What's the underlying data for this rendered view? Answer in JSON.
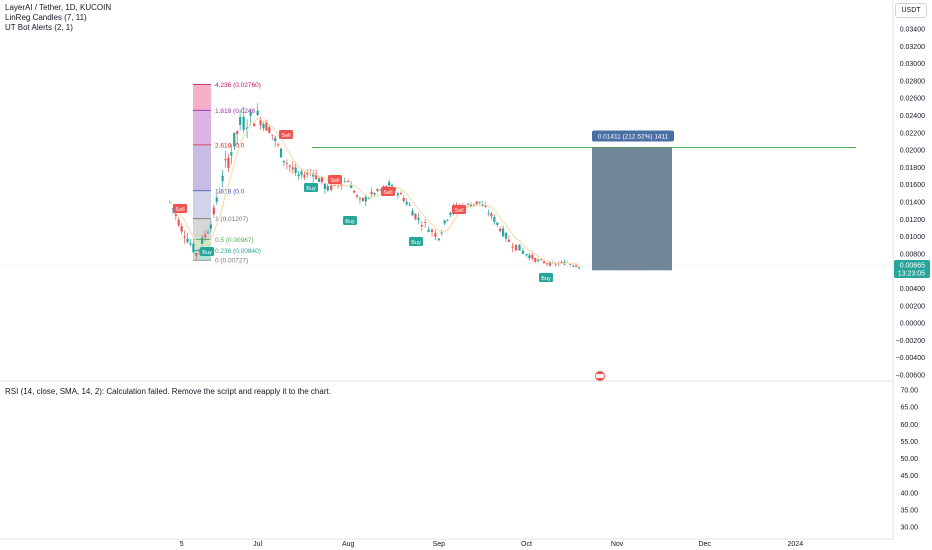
{
  "legend": {
    "symbol": "LayerAI / Tether, 1D, KUCOIN",
    "ind1": "LinReg Candles (7, 11)",
    "ind2": "UT Bot Alerts (2, 1)"
  },
  "currency": "USDT",
  "rsi_message": "RSI (14, close, SMA, 14, 2): Calculation failed. Remove the script and reapply it to the chart.",
  "colors": {
    "up": "#26a69a",
    "down": "#ef5350",
    "hline": "#4caf50",
    "box": "#5b728a",
    "boxlabel": "#4a6fa5"
  },
  "chart_data": {
    "type": "candlestick",
    "price_axis": {
      "ticks": [
        "0.03400",
        "0.03200",
        "0.03000",
        "0.02800",
        "0.02600",
        "0.02400",
        "0.02200",
        "0.02000",
        "0.01800",
        "0.01600",
        "0.01400",
        "0.01200",
        "0.01000",
        "0.00800",
        "0.00600",
        "0.00400",
        "0.00200",
        "0.00000",
        "−0.00200",
        "−0.00400",
        "−0.00600"
      ],
      "range": [
        -0.006,
        0.034
      ]
    },
    "rsi_axis": {
      "ticks": [
        "70.00",
        "65.00",
        "60.00",
        "55.00",
        "50.00",
        "45.00",
        "40.00",
        "35.00",
        "30.00"
      ],
      "range": [
        30,
        70
      ]
    },
    "time_axis": {
      "ticks": [
        "5",
        "Jul",
        "Aug",
        "Sep",
        "Oct",
        "Nov",
        "Dec",
        "2024"
      ]
    },
    "last_price": {
      "value": "0.00665",
      "countdown": "13:23:05"
    },
    "fib_levels": [
      {
        "label": "4.236 (0.02760)",
        "price": 0.0276
      },
      {
        "label": "1.618 (0.0246",
        "price": 0.0246
      },
      {
        "label": "2.618 (0.0",
        "price": 0.0206
      },
      {
        "label": "1.618 (0.0",
        "price": 0.0153
      },
      {
        "label": "1 (0.01207)",
        "price": 0.01207
      },
      {
        "label": "0.5 (0.00967)",
        "price": 0.00967
      },
      {
        "label": "0.236 (0.00840)",
        "price": 0.0084
      },
      {
        "label": "0 (0.00727)",
        "price": 0.00727
      }
    ],
    "horizontal_line": 0.0203,
    "measure_box": {
      "label": "0.01411 (212.52%) 1411",
      "top": 0.0203,
      "bottom": 0.0061
    },
    "signals": [
      {
        "type": "Sell",
        "x": 0.01505
      },
      {
        "type": "Buy",
        "x": 0.0169
      },
      {
        "type": "Sell",
        "x": 0.0259
      },
      {
        "type": "Buy",
        "x": 0.03085
      },
      {
        "type": "Sell",
        "x": 0.0334
      },
      {
        "type": "Buy",
        "x": 0.035
      },
      {
        "type": "Sell",
        "x": 0.041
      },
      {
        "type": "Buy",
        "x": 0.046
      },
      {
        "type": "Sell",
        "x": 0.048
      },
      {
        "type": "Buy",
        "x": 0.06
      }
    ],
    "series": [
      {
        "date": "2023-06-01",
        "o": 0.015,
        "h": 0.017,
        "l": 0.013,
        "c": 0.014
      },
      {
        "date": "2023-06-05",
        "o": 0.014,
        "h": 0.0148,
        "l": 0.0105,
        "c": 0.011
      },
      {
        "date": "2023-06-10",
        "o": 0.011,
        "h": 0.0115,
        "l": 0.0073,
        "c": 0.008
      },
      {
        "date": "2023-06-15",
        "o": 0.008,
        "h": 0.012,
        "l": 0.0075,
        "c": 0.0115
      },
      {
        "date": "2023-06-20",
        "o": 0.0115,
        "h": 0.019,
        "l": 0.011,
        "c": 0.018
      },
      {
        "date": "2023-06-25",
        "o": 0.018,
        "h": 0.025,
        "l": 0.017,
        "c": 0.023
      },
      {
        "date": "2023-07-01",
        "o": 0.023,
        "h": 0.0276,
        "l": 0.0215,
        "c": 0.024
      },
      {
        "date": "2023-07-05",
        "o": 0.024,
        "h": 0.0265,
        "l": 0.022,
        "c": 0.0225
      },
      {
        "date": "2023-07-10",
        "o": 0.0225,
        "h": 0.023,
        "l": 0.0185,
        "c": 0.019
      },
      {
        "date": "2023-07-15",
        "o": 0.019,
        "h": 0.0195,
        "l": 0.0165,
        "c": 0.017
      },
      {
        "date": "2023-07-20",
        "o": 0.017,
        "h": 0.0205,
        "l": 0.016,
        "c": 0.0175
      },
      {
        "date": "2023-07-25",
        "o": 0.0175,
        "h": 0.018,
        "l": 0.015,
        "c": 0.0155
      },
      {
        "date": "2023-08-01",
        "o": 0.0155,
        "h": 0.017,
        "l": 0.0145,
        "c": 0.0165
      },
      {
        "date": "2023-08-05",
        "o": 0.0165,
        "h": 0.0168,
        "l": 0.0135,
        "c": 0.014
      },
      {
        "date": "2023-08-10",
        "o": 0.014,
        "h": 0.0158,
        "l": 0.0136,
        "c": 0.015
      },
      {
        "date": "2023-08-15",
        "o": 0.015,
        "h": 0.017,
        "l": 0.0145,
        "c": 0.016
      },
      {
        "date": "2023-08-20",
        "o": 0.016,
        "h": 0.018,
        "l": 0.014,
        "c": 0.0145
      },
      {
        "date": "2023-08-25",
        "o": 0.0145,
        "h": 0.015,
        "l": 0.0115,
        "c": 0.012
      },
      {
        "date": "2023-09-01",
        "o": 0.012,
        "h": 0.0125,
        "l": 0.0095,
        "c": 0.01
      },
      {
        "date": "2023-09-05",
        "o": 0.01,
        "h": 0.014,
        "l": 0.0095,
        "c": 0.013
      },
      {
        "date": "2023-09-10",
        "o": 0.013,
        "h": 0.0145,
        "l": 0.012,
        "c": 0.0135
      },
      {
        "date": "2023-09-15",
        "o": 0.0135,
        "h": 0.0155,
        "l": 0.0128,
        "c": 0.014
      },
      {
        "date": "2023-09-20",
        "o": 0.014,
        "h": 0.0148,
        "l": 0.0115,
        "c": 0.012
      },
      {
        "date": "2023-09-25",
        "o": 0.012,
        "h": 0.0125,
        "l": 0.009,
        "c": 0.0095
      },
      {
        "date": "2023-10-01",
        "o": 0.0095,
        "h": 0.0098,
        "l": 0.0075,
        "c": 0.008
      },
      {
        "date": "2023-10-05",
        "o": 0.008,
        "h": 0.0085,
        "l": 0.0068,
        "c": 0.0072
      },
      {
        "date": "2023-10-10",
        "o": 0.0072,
        "h": 0.0078,
        "l": 0.0062,
        "c": 0.0068
      },
      {
        "date": "2023-10-15",
        "o": 0.0068,
        "h": 0.0085,
        "l": 0.0062,
        "c": 0.007
      },
      {
        "date": "2023-10-20",
        "o": 0.007,
        "h": 0.0075,
        "l": 0.0062,
        "c": 0.0066
      }
    ]
  }
}
